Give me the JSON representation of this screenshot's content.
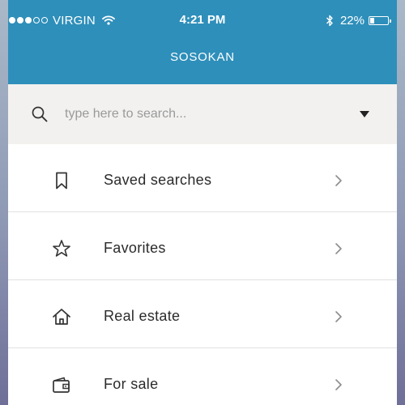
{
  "status_bar": {
    "carrier": "VIRGIN",
    "time": "4:21 PM",
    "battery_percent_label": "22%",
    "battery_level": 0.22,
    "signal_bars_filled": 3,
    "signal_bars_total": 5,
    "icons": [
      "wifi-icon",
      "bluetooth-icon",
      "battery-icon"
    ]
  },
  "header": {
    "title": "SOSOKAN",
    "background_color": "#2e8fba"
  },
  "search": {
    "placeholder": "type here to search...",
    "value": "",
    "icon": "search-icon",
    "dropdown_icon": "caret-down-icon"
  },
  "menu": {
    "items": [
      {
        "label": "Saved searches",
        "icon": "bookmark-icon"
      },
      {
        "label": "Favorites",
        "icon": "star-icon"
      },
      {
        "label": "Real estate",
        "icon": "house-icon"
      },
      {
        "label": "For sale",
        "icon": "wallet-icon"
      }
    ]
  }
}
